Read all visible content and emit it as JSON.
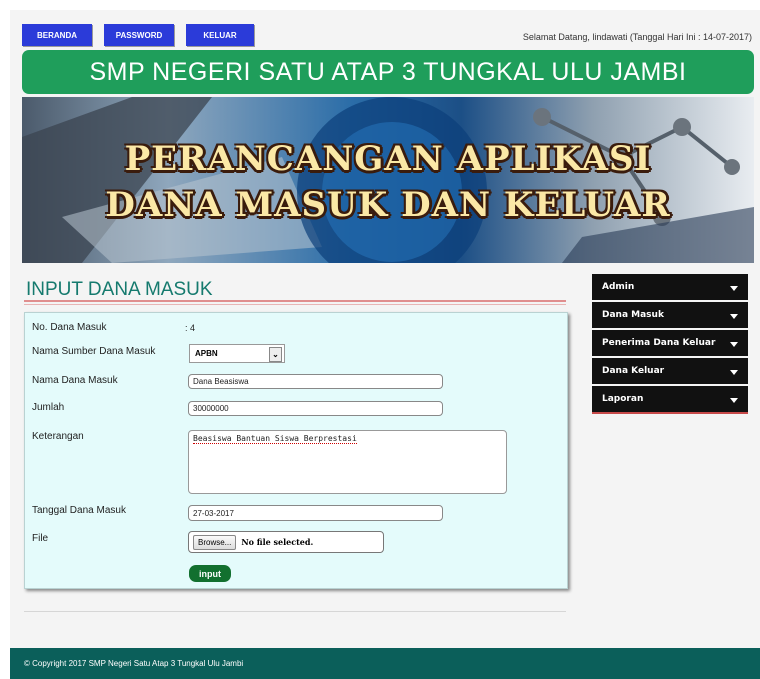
{
  "nav": {
    "items": [
      "BERANDA",
      "PASSWORD",
      "KELUAR"
    ],
    "welcome": "Selamat Datang, lindawati (Tanggal Hari Ini : 14-07-2017)"
  },
  "header": {
    "school": "SMP NEGERI SATU ATAP 3 TUNGKAL ULU JAMBI",
    "banner_line1": "PERANCANGAN APLIKASI",
    "banner_line2": "DANA MASUK DAN KELUAR"
  },
  "main": {
    "title": "INPUT DANA MASUK",
    "form": {
      "no_label": "No. Dana Masuk",
      "no_value": ": 4",
      "sumber_label": "Nama Sumber Dana Masuk",
      "sumber_value": "APBN",
      "nama_label": "Nama Dana Masuk",
      "nama_value": "Dana Beasiswa",
      "jumlah_label": "Jumlah",
      "jumlah_value": "30000000",
      "ket_label": "Keterangan",
      "ket_value": "Beasiswa Bantuan Siswa Berprestasi",
      "tanggal_label": "Tanggal Dana Masuk",
      "tanggal_value": "27-03-2017",
      "file_label": "File",
      "browse_label": "Browse...",
      "file_status": "No file selected.",
      "submit_label": "input"
    }
  },
  "sidebar": {
    "items": [
      "Admin",
      "Dana Masuk",
      "Penerima Dana Keluar",
      "Dana Keluar",
      "Laporan"
    ]
  },
  "footer": {
    "text": "© Copyright 2017 SMP Negeri Satu Atap 3 Tungkal Ulu Jambi"
  },
  "colors": {
    "nav_button": "#2b3bd9",
    "title_bar": "#1f9e5b",
    "section_title": "#157a6e",
    "form_background": "#e4fbfb",
    "sidebar": "#111111",
    "footer": "#0b5f5a",
    "submit": "#12702f"
  }
}
